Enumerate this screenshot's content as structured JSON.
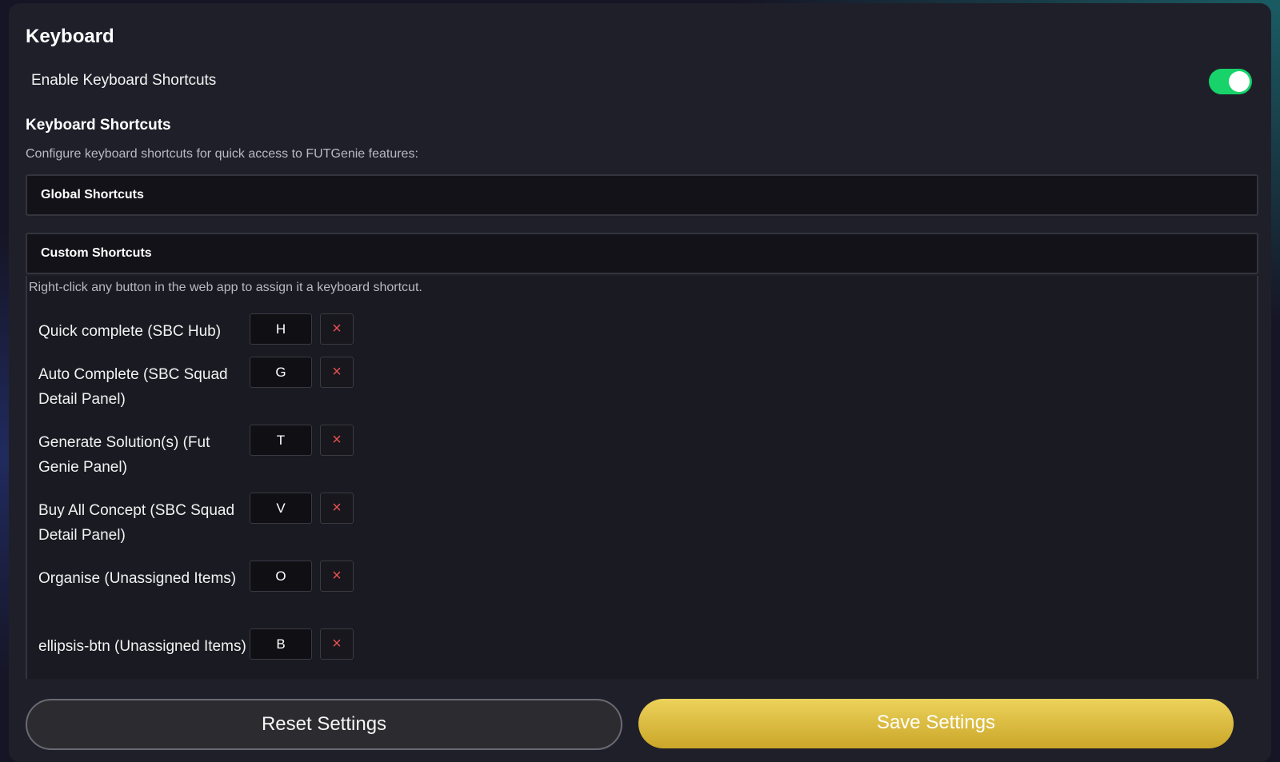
{
  "section": {
    "title": "Keyboard"
  },
  "toggle": {
    "label": "Enable Keyboard Shortcuts",
    "enabled": true,
    "on_color": "#17d36a"
  },
  "shortcuts": {
    "title": "Keyboard Shortcuts",
    "description": "Configure keyboard shortcuts for quick access to FUTGenie features:"
  },
  "global": {
    "title": "Global Shortcuts"
  },
  "custom": {
    "title": "Custom Shortcuts",
    "description": "Right-click any button in the web app to assign it a keyboard shortcut.",
    "items": [
      {
        "label": "Quick complete (SBC Hub)",
        "key": "H",
        "remove_icon": "×"
      },
      {
        "label": "Auto Complete (SBC Squad Detail Panel)",
        "key": "G",
        "remove_icon": "×"
      },
      {
        "label": "Generate Solution(s) (Fut Genie Panel)",
        "key": "T",
        "remove_icon": "×"
      },
      {
        "label": "Buy All Concept (SBC Squad Detail Panel)",
        "key": "V",
        "remove_icon": "×"
      },
      {
        "label": "Organise (Unassigned Items)",
        "key": "O",
        "remove_icon": "×"
      },
      {
        "label": "ellipsis-btn (Unassigned Items)",
        "key": "B",
        "remove_icon": "×"
      }
    ]
  },
  "footer": {
    "reset_label": "Reset Settings",
    "save_label": "Save Settings",
    "save_color": "#d9b93c"
  }
}
